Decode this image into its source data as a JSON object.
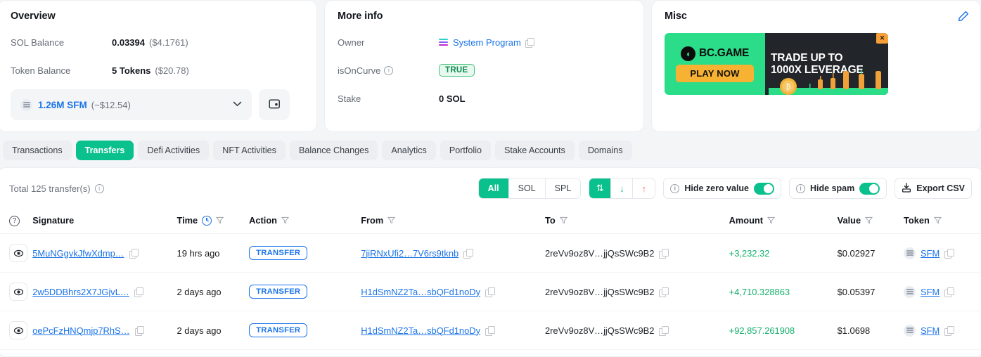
{
  "overview": {
    "title": "Overview",
    "rows": [
      {
        "label": "SOL Balance",
        "value": "0.03394",
        "sub": "($4.1761)"
      },
      {
        "label": "Token Balance",
        "value": "5 Tokens",
        "sub": "($20.78)"
      }
    ],
    "token_select": {
      "amount": "1.26M SFM",
      "usd": "(~$12.54)",
      "chevron": "chevron-down-icon",
      "wallet_icon": "wallet-icon"
    }
  },
  "more_info": {
    "title": "More info",
    "owner_label": "Owner",
    "owner_value": "System Program",
    "is_on_curve_label": "isOnCurve",
    "is_on_curve_value": "TRUE",
    "stake_label": "Stake",
    "stake_value": "0 SOL"
  },
  "misc": {
    "title": "Misc",
    "edit_icon": "pencil-icon",
    "ad": {
      "brand": "BC.GAME",
      "cta": "PLAY NOW",
      "headline_line1": "TRADE UP TO",
      "headline_line2": "1000X LEVERAGE",
      "close": "✕"
    }
  },
  "tabs": [
    {
      "label": "Transactions",
      "active": false
    },
    {
      "label": "Transfers",
      "active": true
    },
    {
      "label": "Defi Activities",
      "active": false
    },
    {
      "label": "NFT Activities",
      "active": false
    },
    {
      "label": "Balance Changes",
      "active": false
    },
    {
      "label": "Analytics",
      "active": false
    },
    {
      "label": "Portfolio",
      "active": false
    },
    {
      "label": "Stake Accounts",
      "active": false
    },
    {
      "label": "Domains",
      "active": false
    }
  ],
  "toolbar": {
    "total_text": "Total 125 transfer(s)",
    "filters": [
      {
        "label": "All",
        "active": true
      },
      {
        "label": "SOL",
        "active": false
      },
      {
        "label": "SPL",
        "active": false
      }
    ],
    "sort": [
      {
        "icon": "sort-both-icon",
        "glyph": "⇅",
        "active": true
      },
      {
        "icon": "arrow-down-icon",
        "glyph": "↓",
        "active": false
      },
      {
        "icon": "arrow-up-icon",
        "glyph": "↑",
        "active": false
      }
    ],
    "hide_zero_value": {
      "label": "Hide zero value",
      "on": true
    },
    "hide_spam": {
      "label": "Hide spam",
      "on": true
    },
    "export_csv": "Export CSV"
  },
  "table": {
    "columns": [
      {
        "key": "eye",
        "label": ""
      },
      {
        "key": "signature",
        "label": "Signature"
      },
      {
        "key": "time",
        "label": "Time"
      },
      {
        "key": "action",
        "label": "Action"
      },
      {
        "key": "from",
        "label": "From"
      },
      {
        "key": "to",
        "label": "To"
      },
      {
        "key": "amount",
        "label": "Amount"
      },
      {
        "key": "value",
        "label": "Value"
      },
      {
        "key": "token",
        "label": "Token"
      }
    ],
    "rows": [
      {
        "signature": "5MuNGgvkJfwXdmp…",
        "time": "19 hrs ago",
        "action": "TRANSFER",
        "from": "7jiRNxUfi2…7V6rs9tknb",
        "to": "2reVv9oz8V…jjQsSWc9B2",
        "amount": "+3,232.32",
        "value": "$0.02927",
        "token": "SFM"
      },
      {
        "signature": "2w5DDBhrs2X7JGjvL…",
        "time": "2 days ago",
        "action": "TRANSFER",
        "from": "H1dSmNZ2Ta…sbQFd1noDy",
        "to": "2reVv9oz8V…jjQsSWc9B2",
        "amount": "+4,710.328863",
        "value": "$0.05397",
        "token": "SFM"
      },
      {
        "signature": "oePcFzHNQmjp7RhS…",
        "time": "2 days ago",
        "action": "TRANSFER",
        "from": "H1dSmNZ2Ta…sbQFd1noDy",
        "to": "2reVv9oz8V…jjQsSWc9B2",
        "amount": "+92,857.261908",
        "value": "$1.0698",
        "token": "SFM"
      }
    ]
  },
  "colors": {
    "accent_green": "#0ac18e",
    "link_blue": "#1a73e8",
    "amount_green": "#13b06a",
    "badge_green": "#0e8a4e"
  }
}
